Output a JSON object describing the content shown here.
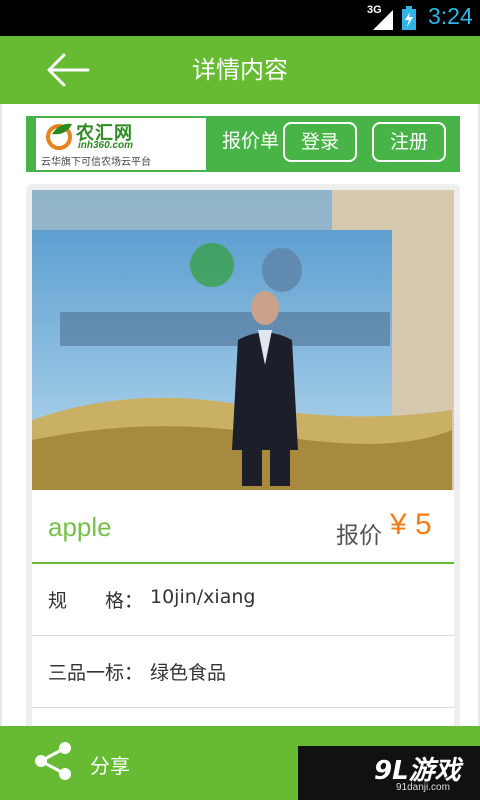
{
  "statusbar": {
    "network": "3G",
    "time": "3:24",
    "clock_color": "#31b5e5"
  },
  "titlebar": {
    "title": "详情内容",
    "color": "#66bb33"
  },
  "banner": {
    "logo_name": "农汇网",
    "logo_domain": "inh360.com",
    "logo_slogan": "云华旗下可信农场云平台",
    "title": "报价单",
    "login_label": "登录",
    "register_label": "注册",
    "color": "#48b347"
  },
  "product": {
    "name": "apple",
    "price_label": "报价",
    "price_value": "¥ 5",
    "name_color": "#77c04b",
    "price_color": "#f57b14",
    "specs": [
      {
        "key": "规　　格：",
        "value": "10jin/xiang"
      },
      {
        "key": "三品一标：",
        "value": "绿色食品"
      }
    ]
  },
  "footer": {
    "share_label": "分享",
    "watermark": "9L游戏",
    "watermark_domain": "91danji.com"
  }
}
